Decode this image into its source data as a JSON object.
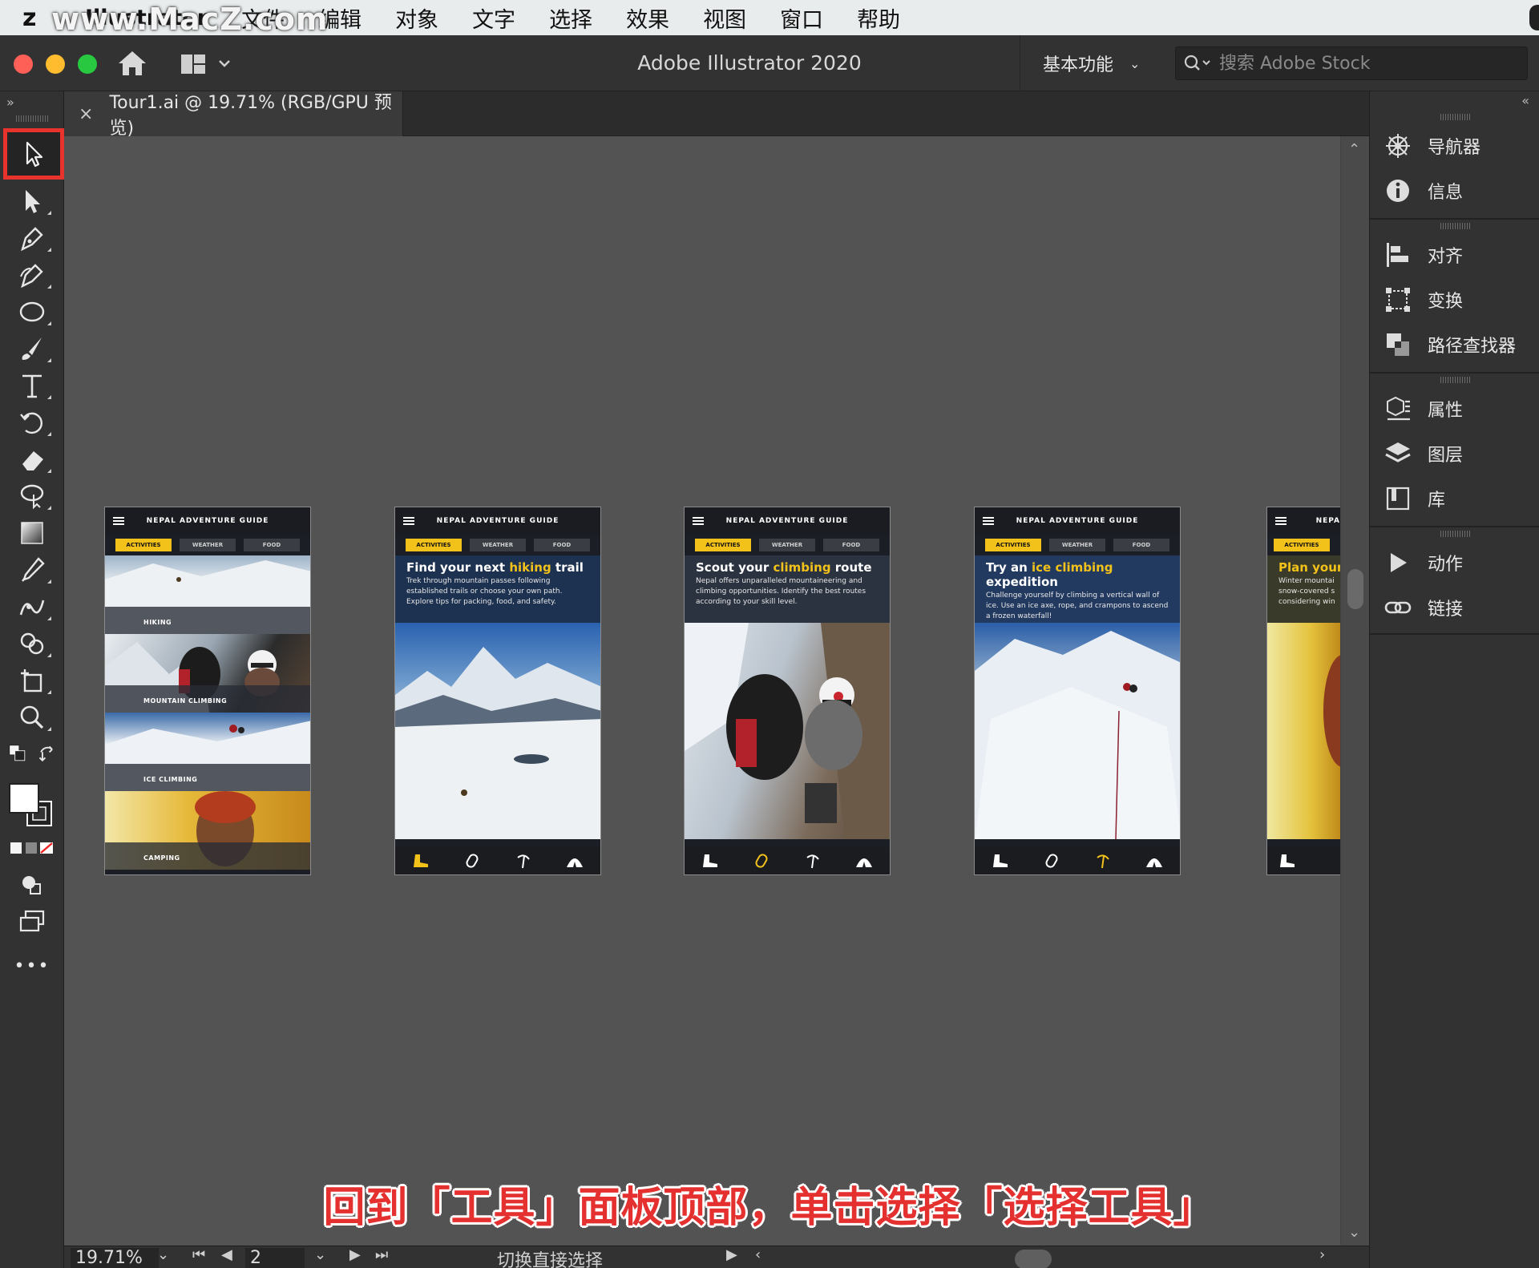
{
  "menubar": {
    "watermark": "www.MacZ.com",
    "app_name": "Illustrator",
    "items": [
      "文件",
      "编辑",
      "对象",
      "文字",
      "选择",
      "效果",
      "视图",
      "窗口",
      "帮助"
    ]
  },
  "titlebar": {
    "title": "Adobe Illustrator 2020",
    "workspace": "基本功能",
    "search_placeholder": "搜索 Adobe Stock"
  },
  "document_tab": {
    "close": "×",
    "label": "Tour1.ai @ 19.71% (RGB/GPU 预览)"
  },
  "tools": [
    "selection-tool",
    "direct-selection-tool",
    "pen-tool",
    "curvature-tool",
    "ellipse-tool",
    "paintbrush-tool",
    "type-tool",
    "rotate-tool",
    "eraser-tool",
    "lasso-tool",
    "gradient-tool",
    "eyedropper-tool",
    "width-tool",
    "shape-builder-tool",
    "artboard-tool",
    "zoom-tool"
  ],
  "tools_more": "•••",
  "artboards": [
    {
      "header": "NEPAL ADVENTURE GUIDE",
      "tabs": [
        "ACTIVITIES",
        "WEATHER",
        "FOOD"
      ],
      "list": [
        "HIKING",
        "MOUNTAIN CLIMBING",
        "ICE CLIMBING",
        "CAMPING"
      ]
    },
    {
      "header": "NEPAL ADVENTURE GUIDE",
      "tabs": [
        "ACTIVITIES",
        "WEATHER",
        "FOOD"
      ],
      "hero_title_parts": [
        "Find your next ",
        "hiking",
        " trail"
      ],
      "hero_text": "Trek through mountain passes following established trails or choose your own path. Explore tips for packing, food, and safety."
    },
    {
      "header": "NEPAL ADVENTURE GUIDE",
      "tabs": [
        "ACTIVITIES",
        "WEATHER",
        "FOOD"
      ],
      "hero_title_parts": [
        "Scout your ",
        "climbing",
        " route"
      ],
      "hero_text": "Nepal offers unparalleled mountaineering and climbing opportunities. Identify the best routes according to your skill level."
    },
    {
      "header": "NEPAL ADVENTURE GUIDE",
      "tabs": [
        "ACTIVITIES",
        "WEATHER",
        "FOOD"
      ],
      "hero_title_parts": [
        "Try an ",
        "ice climbing",
        " expedition"
      ],
      "hero_text": "Challenge yourself by climbing a vertical wall of ice. Use an ice axe, rope, and crampons to ascend a frozen waterfall!"
    },
    {
      "header": "NEPA",
      "tabs": [
        "ACTIVITIES"
      ],
      "hero_title_parts": [
        "Plan your"
      ],
      "hero_text": "Winter mountai snow-covered s considering win"
    }
  ],
  "right_panel": {
    "group1": [
      "导航器",
      "信息"
    ],
    "group2": [
      "对齐",
      "变换",
      "路径查找器"
    ],
    "group3": [
      "属性",
      "图层",
      "库"
    ],
    "group4": [
      "动作",
      "链接"
    ]
  },
  "statusbar": {
    "zoom": "19.71%",
    "page": "2",
    "status_text": "切换直接选择"
  },
  "caption": "回到「工具」面板顶部，单击选择「选择工具」",
  "colors": {
    "highlight": "#e8332d",
    "app_accent_yellow": "#f2c21b",
    "caption_red": "#e53030"
  }
}
